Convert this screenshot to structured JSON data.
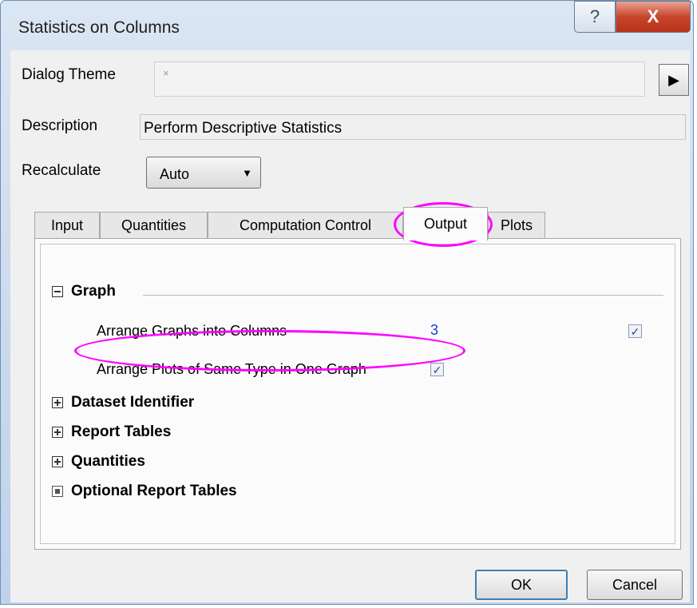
{
  "window": {
    "title": "Statistics on Columns",
    "help_glyph": "?",
    "close_glyph": "X"
  },
  "theme": {
    "label": "Dialog Theme",
    "value": "",
    "placeholder_glyph": "×",
    "menu_arrow": "▶"
  },
  "description": {
    "label": "Description",
    "value": "Perform Descriptive Statistics"
  },
  "recalculate": {
    "label": "Recalculate",
    "value": "Auto",
    "arrow": "▼"
  },
  "tabs": [
    {
      "label": "Input"
    },
    {
      "label": "Quantities"
    },
    {
      "label": "Computation Control"
    },
    {
      "label": "Output",
      "active": true
    },
    {
      "label": "Plots"
    }
  ],
  "output": {
    "graph": {
      "label": "Graph",
      "rows": [
        {
          "label": "Arrange Graphs into Columns",
          "value": "3",
          "checked": true
        },
        {
          "label": "Arrange Plots of Same Type in One Graph",
          "checked": true
        }
      ]
    },
    "sections": [
      {
        "label": "Dataset Identifier"
      },
      {
        "label": "Report Tables"
      },
      {
        "label": "Quantities"
      },
      {
        "label": "Optional Report Tables"
      }
    ]
  },
  "buttons": {
    "ok": "OK",
    "cancel": "Cancel"
  },
  "colors": {
    "highlight": "#ff00ff",
    "value_blue": "#1a3ad6"
  },
  "check_glyph": "✓"
}
